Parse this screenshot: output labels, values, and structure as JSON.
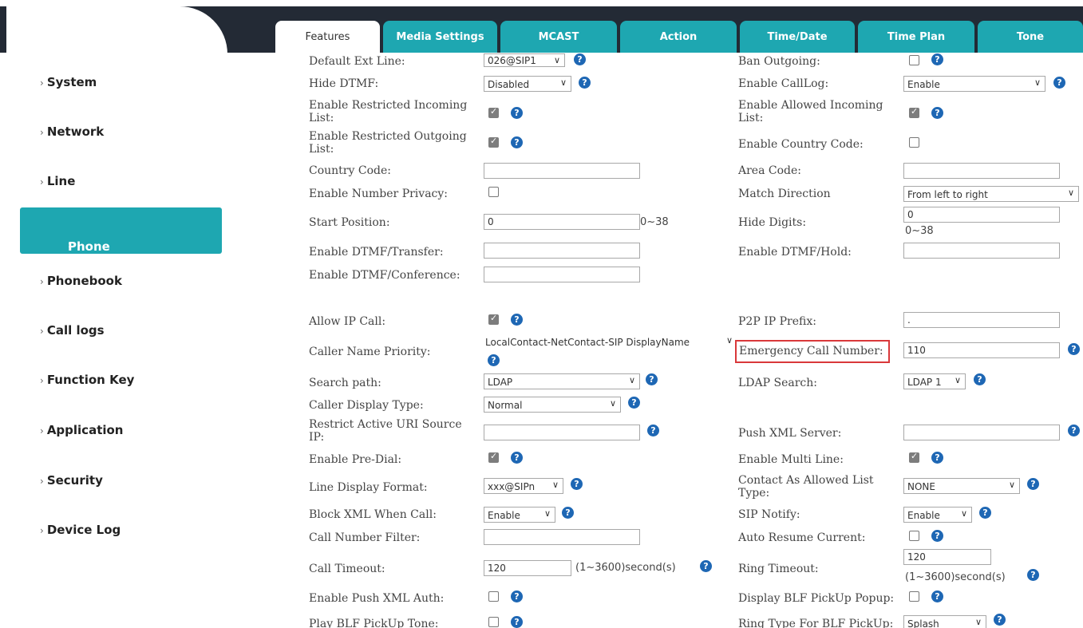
{
  "tabs": [
    "Features",
    "Media Settings",
    "MCAST",
    "Action",
    "Time/Date",
    "Time Plan",
    "Tone"
  ],
  "sidebar": {
    "items": [
      "System",
      "Network",
      "Line",
      "Phone settings",
      "Phonebook",
      "Call logs",
      "Function Key",
      "Application",
      "Security",
      "Device Log"
    ],
    "active": "Phone settings"
  },
  "left": {
    "default_ext_line": {
      "label": "Default Ext Line:",
      "value": "026@SIP1"
    },
    "hide_dtmf": {
      "label": "Hide DTMF:",
      "value": "Disabled"
    },
    "restricted_incoming": {
      "label": "Enable Restricted Incoming List:",
      "checked": true
    },
    "restricted_outgoing": {
      "label": "Enable Restricted Outgoing List:",
      "checked": true
    },
    "country_code": {
      "label": "Country Code:",
      "value": ""
    },
    "number_privacy": {
      "label": "Enable Number Privacy:",
      "checked": false
    },
    "start_position": {
      "label": "Start Position:",
      "value": "0",
      "range": "0~38"
    },
    "dtmf_transfer": {
      "label": "Enable DTMF/Transfer:",
      "value": ""
    },
    "dtmf_conference": {
      "label": "Enable DTMF/Conference:",
      "value": ""
    },
    "allow_ip_call": {
      "label": "Allow IP Call:",
      "checked": true
    },
    "caller_name_priority": {
      "label": "Caller Name Priority:",
      "value": "LocalContact-NetContact-SIP DisplayName"
    },
    "search_path": {
      "label": "Search path:",
      "value": "LDAP"
    },
    "caller_display_type": {
      "label": "Caller Display Type:",
      "value": "Normal"
    },
    "restrict_uri": {
      "label": "Restrict Active URI Source IP:",
      "value": ""
    },
    "pre_dial": {
      "label": "Enable Pre-Dial:",
      "checked": true
    },
    "line_display_format": {
      "label": "Line Display Format:",
      "value": "xxx@SIPn"
    },
    "block_xml": {
      "label": "Block XML When Call:",
      "value": "Enable"
    },
    "call_number_filter": {
      "label": "Call Number Filter:",
      "value": ""
    },
    "call_timeout": {
      "label": "Call Timeout:",
      "value": "120",
      "unit": "(1~3600)second(s)"
    },
    "push_xml_auth": {
      "label": "Enable Push XML Auth:",
      "checked": false
    },
    "blf_pickup_tone": {
      "label": "Play BLF PickUp Tone:",
      "checked": false
    }
  },
  "right": {
    "ban_outgoing": {
      "label": "Ban Outgoing:",
      "checked": false
    },
    "enable_calllog": {
      "label": "Enable CallLog:",
      "value": "Enable"
    },
    "allowed_incoming": {
      "label": "Enable Allowed Incoming List:",
      "checked": true
    },
    "enable_country_code": {
      "label": "Enable Country Code:",
      "checked": false
    },
    "area_code": {
      "label": "Area Code:",
      "value": ""
    },
    "match_direction": {
      "label": "Match Direction",
      "value": "From left to right"
    },
    "hide_digits": {
      "label": "Hide Digits:",
      "value": "0",
      "range": "0~38"
    },
    "dtmf_hold": {
      "label": "Enable DTMF/Hold:",
      "value": ""
    },
    "p2p_ip_prefix": {
      "label": "P2P IP Prefix:",
      "value": "."
    },
    "emergency_call_number": {
      "label": "Emergency Call Number:",
      "value": "110"
    },
    "ldap_search": {
      "label": "LDAP Search:",
      "value": "LDAP 1"
    },
    "push_xml_server": {
      "label": "Push XML Server:",
      "value": ""
    },
    "multi_line": {
      "label": "Enable Multi Line:",
      "checked": true
    },
    "contact_allowed_list": {
      "label": "Contact As Allowed List Type:",
      "value": "NONE"
    },
    "sip_notify": {
      "label": "SIP Notify:",
      "value": "Enable"
    },
    "auto_resume": {
      "label": "Auto Resume Current:",
      "checked": false
    },
    "ring_timeout": {
      "label": "Ring Timeout:",
      "value": "120",
      "unit": "(1~3600)second(s)"
    },
    "blf_pickup_popup": {
      "label": "Display BLF PickUp Popup:",
      "checked": false
    },
    "ring_type_blf": {
      "label": "Ring Type For BLF PickUp:",
      "value": "Splash"
    }
  },
  "help_glyph": "?",
  "chevron": "∨",
  "colors": {
    "accent": "#1ea7b1",
    "topbar": "#232a35",
    "help": "#1e67b4",
    "highlight": "#d9383a"
  }
}
